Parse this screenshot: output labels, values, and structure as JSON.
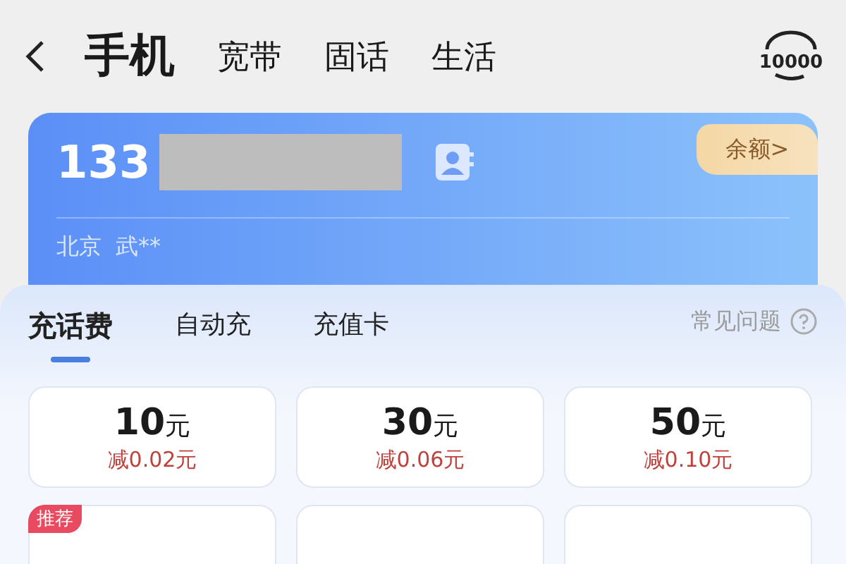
{
  "nav": {
    "tabs": [
      {
        "label": "手机",
        "selected": true
      },
      {
        "label": "宽带",
        "selected": false
      },
      {
        "label": "固话",
        "selected": false
      },
      {
        "label": "生活",
        "selected": false
      }
    ]
  },
  "service_logo": "10000",
  "account": {
    "number_prefix": "133",
    "region": "北京",
    "name": "武**",
    "balance_link": "余额>"
  },
  "recharge": {
    "tabs": [
      {
        "label": "充话费",
        "selected": true
      },
      {
        "label": "自动充",
        "selected": false
      },
      {
        "label": "充值卡",
        "selected": false
      }
    ],
    "help": "常见问题",
    "options": [
      {
        "kind": "price",
        "amount": "10",
        "unit": "元",
        "discount": "减0.02元"
      },
      {
        "kind": "price",
        "amount": "30",
        "unit": "元",
        "discount": "减0.06元"
      },
      {
        "kind": "price",
        "amount": "50",
        "unit": "元",
        "discount": "减0.10元"
      },
      {
        "kind": "cutoff",
        "badge": "推荐"
      },
      {
        "kind": "cutoff"
      },
      {
        "kind": "cutoff"
      }
    ]
  }
}
